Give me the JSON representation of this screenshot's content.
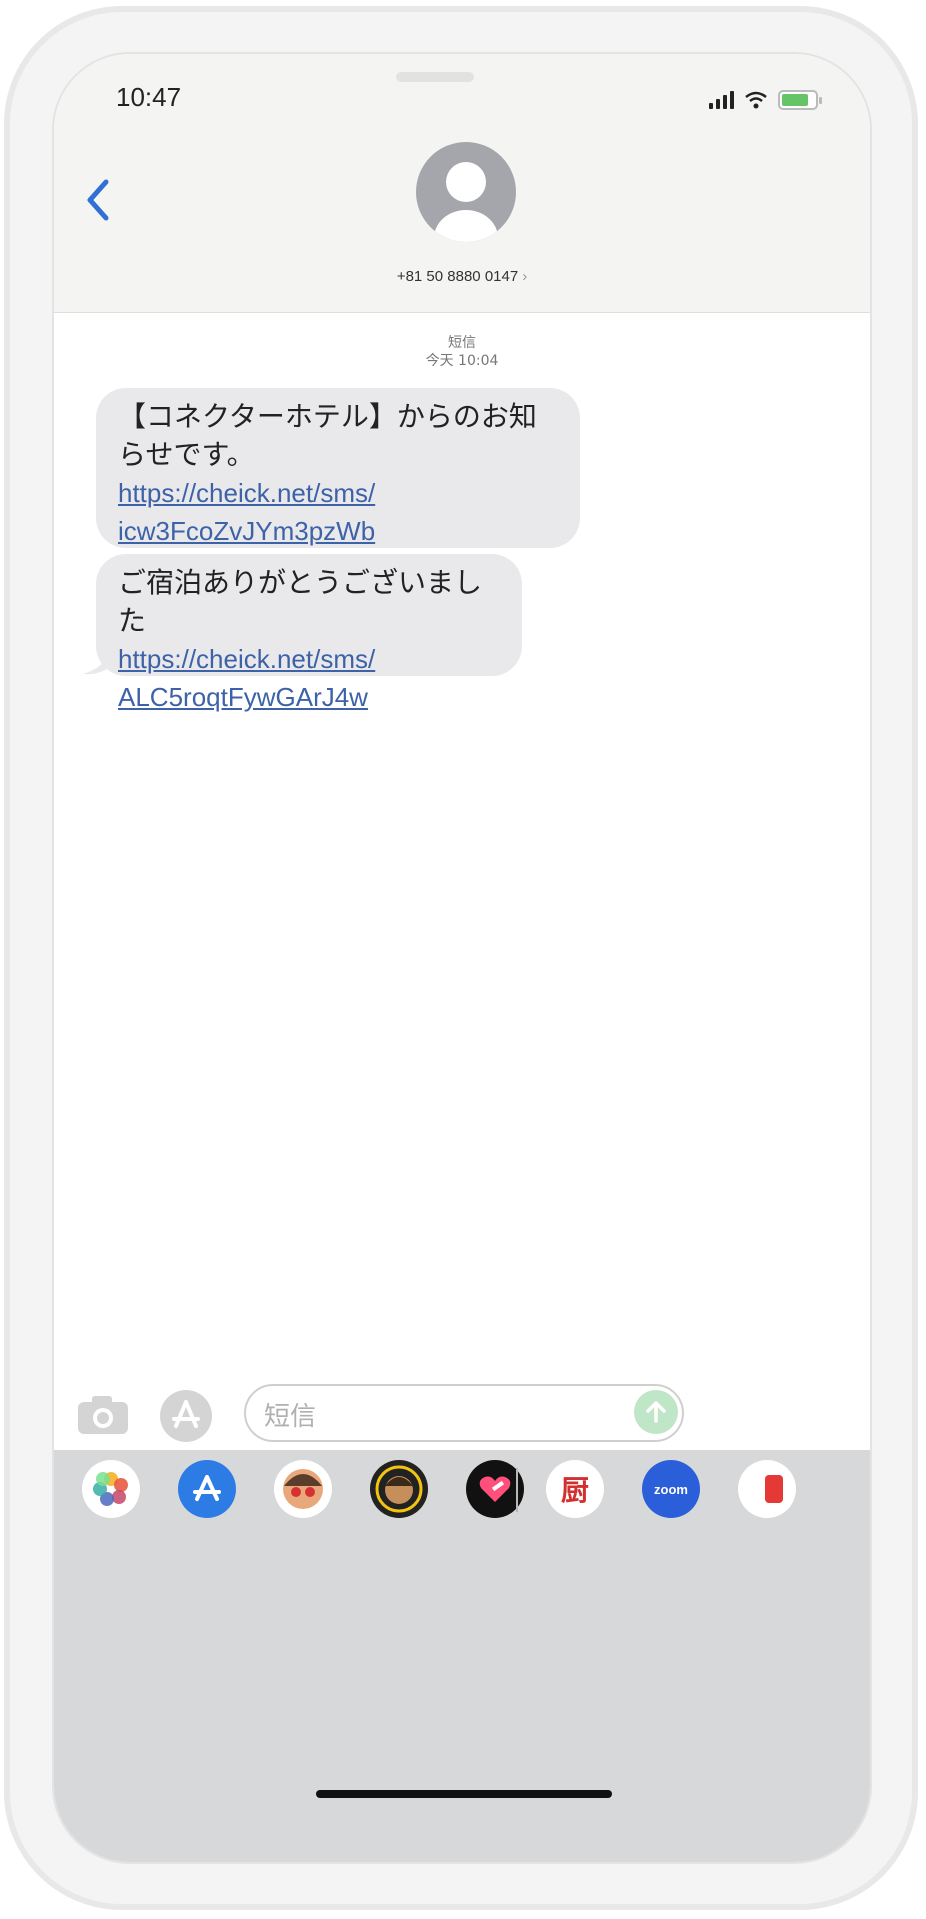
{
  "status_bar": {
    "time": "10:47"
  },
  "header": {
    "contact": "+81 50 8880 0147",
    "contact_chevron": "›"
  },
  "conversation": {
    "service": "短信",
    "timestamp": "今天 10:04",
    "messages": [
      {
        "text": "【コネクターホテル】からのお知らせです。",
        "link_line1": "https://cheick.net/sms/",
        "link_line2": "icw3FcoZvJYm3pzWb"
      },
      {
        "text": "ご宿泊ありがとうございました",
        "link_line1": "https://cheick.net/sms/",
        "link_line2": "ALC5roqtFywGArJ4w"
      }
    ]
  },
  "composer": {
    "placeholder": "短信"
  },
  "app_strip": {
    "icons": [
      "photos-icon",
      "app-store-icon",
      "memoji-icon",
      "animoji-icon",
      "digital-touch-icon",
      "kitchen-app-icon",
      "zoom-icon",
      "partial-app-icon"
    ],
    "zoom_label": "zoom",
    "kitchen_label": "厨"
  },
  "colors": {
    "link": "#3d62a8",
    "bubble": "#e9e9eb",
    "accent_back": "#2f6fd6",
    "send_button": "#bfe6c6"
  }
}
